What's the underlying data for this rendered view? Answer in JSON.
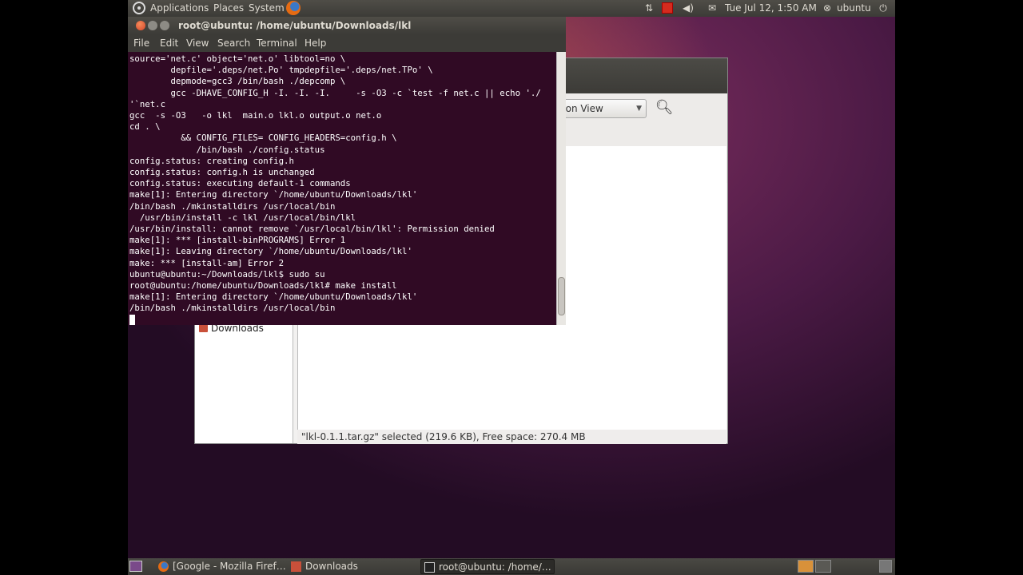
{
  "top_panel": {
    "menus": [
      "Applications",
      "Places",
      "System"
    ],
    "clock": "Tue Jul 12,  1:50 AM",
    "user": "ubuntu",
    "icons": [
      "ubuntu-logo-icon",
      "firefox-icon",
      "network-icon",
      "notification-icon",
      "volume-icon",
      "mail-icon",
      "user-icon",
      "power-icon"
    ]
  },
  "terminal": {
    "title": "root@ubuntu: /home/ubuntu/Downloads/lkl",
    "menu": [
      "File",
      "Edit",
      "View",
      "Search",
      "Terminal",
      "Help"
    ],
    "lines": [
      "source='net.c' object='net.o' libtool=no \\",
      "        depfile='.deps/net.Po' tmpdepfile='.deps/net.TPo' \\",
      "        depmode=gcc3 /bin/bash ./depcomp \\",
      "        gcc -DHAVE_CONFIG_H -I. -I. -I.     -s -O3 -c `test -f net.c || echo './",
      "'`net.c",
      "gcc  -s -O3   -o lkl  main.o lkl.o output.o net.o",
      "cd . \\",
      "          && CONFIG_FILES= CONFIG_HEADERS=config.h \\",
      "             /bin/bash ./config.status",
      "config.status: creating config.h",
      "config.status: config.h is unchanged",
      "config.status: executing default-1 commands",
      "make[1]: Entering directory `/home/ubuntu/Downloads/lkl'",
      "/bin/bash ./mkinstalldirs /usr/local/bin",
      "  /usr/bin/install -c lkl /usr/local/bin/lkl",
      "/usr/bin/install: cannot remove `/usr/local/bin/lkl': Permission denied",
      "make[1]: *** [install-binPROGRAMS] Error 1",
      "make[1]: Leaving directory `/home/ubuntu/Downloads/lkl'",
      "make: *** [install-am] Error 2",
      "ubuntu@ubuntu:~/Downloads/lkl$ sudo su",
      "root@ubuntu:/home/ubuntu/Downloads/lkl# make install",
      "make[1]: Entering directory `/home/ubuntu/Downloads/lkl'",
      "/bin/bash ./mkinstalldirs /usr/local/bin"
    ]
  },
  "file_manager": {
    "view_mode": "con View",
    "sidebar_item": "Downloads",
    "statusbar": "\"lkl-0.1.1.tar.gz\" selected (219.6 KB), Free space: 270.4 MB"
  },
  "bottom_panel": {
    "tasks": [
      {
        "label": "[Google - Mozilla Firef…",
        "icon": "firefox-icon"
      },
      {
        "label": "Downloads",
        "icon": "folder-icon"
      },
      {
        "label": "root@ubuntu: /home/…",
        "icon": "terminal-icon"
      }
    ]
  },
  "colors": {
    "terminal_bg": "#300a24",
    "panel_bg": "#3c3b37",
    "close_button": "#d6462a"
  }
}
